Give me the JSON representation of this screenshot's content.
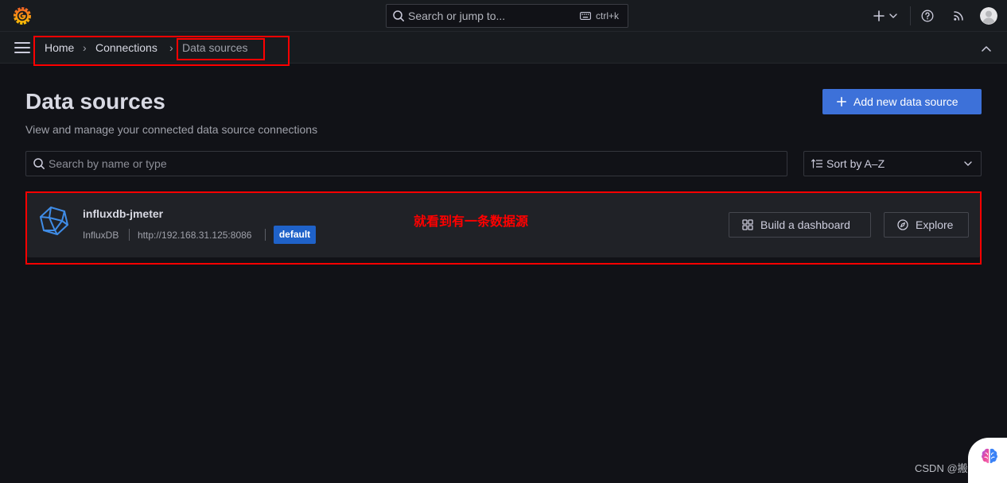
{
  "topbar": {
    "logo_icon": "grafana-logo-icon",
    "search": {
      "placeholder": "Search or jump to...",
      "shortcut": "ctrl+k",
      "icon": "search-icon",
      "shortcut_icon": "keyboard-icon"
    },
    "new_menu_icon": "plus-icon",
    "help_icon": "help-circle-icon",
    "news_icon": "rss-icon",
    "profile_icon": "avatar-icon"
  },
  "breadcrumb": {
    "separator": "›",
    "items": [
      {
        "label": "Home",
        "current": false
      },
      {
        "label": "Connections",
        "current": false
      },
      {
        "label": "Data sources",
        "current": true
      }
    ]
  },
  "page": {
    "title": "Data sources",
    "subtitle": "View and manage your connected data source connections",
    "add_button": {
      "label": "Add new data source",
      "icon": "plus-icon"
    }
  },
  "filters": {
    "search": {
      "placeholder": "Search by name or type",
      "icon": "search-icon"
    },
    "sort": {
      "selected": "Sort by A–Z",
      "icon": "sort-icon"
    }
  },
  "datasources": [
    {
      "name": "influxdb-jmeter",
      "type": "InfluxDB",
      "url": "http://192.168.31.125:8086",
      "badge": "default",
      "icon": "influxdb-logo-icon",
      "actions": [
        {
          "label": "Build a dashboard",
          "icon": "grid-icon"
        },
        {
          "label": "Explore",
          "icon": "compass-icon"
        }
      ]
    }
  ],
  "annotations": {
    "note": "就看到有一条数据源"
  },
  "watermark": "CSDN @搬代码",
  "colors": {
    "canvas": "#111217",
    "panel": "#181b1f",
    "card": "#202227",
    "border": "#34363d",
    "text": "#ccccdc",
    "muted": "#9fa1aa",
    "accent": "#3d71d9",
    "badge": "#1f62c9",
    "annotation": "#ff0000"
  }
}
